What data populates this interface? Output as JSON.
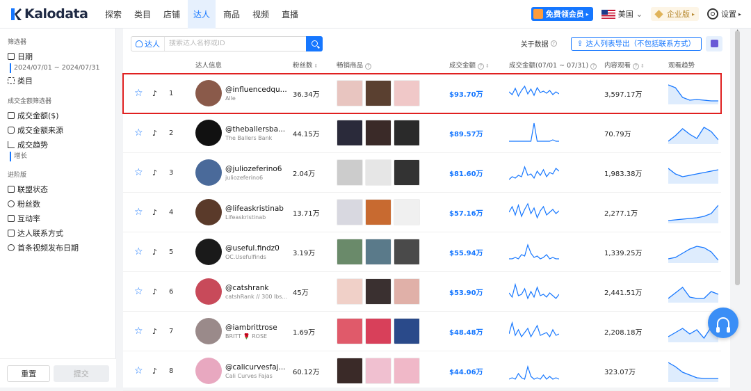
{
  "app": {
    "name": "Kalodata"
  },
  "nav": {
    "items": [
      "探索",
      "类目",
      "店铺",
      "达人",
      "商品",
      "视频",
      "直播"
    ],
    "active_index": 3,
    "promo_label": "免费领会员",
    "country": "美国",
    "enterprise_label": "企业版",
    "settings_label": "设置"
  },
  "sidebar": {
    "filter_title": "筛选器",
    "date_label": "日期",
    "date_range": "2024/07/01 ~ 2024/07/31",
    "category_label": "类目",
    "gmv_filter_title": "成交金额筛选器",
    "gmv_items": [
      "成交金额($)",
      "成交金额来源",
      "成交趋势"
    ],
    "trend_sub": "增长",
    "advanced_title": "进阶版",
    "advanced_items": [
      "联盟状态",
      "粉丝数",
      "互动率",
      "达人联系方式",
      "首条视频发布日期"
    ],
    "reset_label": "重置",
    "submit_label": "提交"
  },
  "toolbar": {
    "search_type": "达人",
    "search_placeholder": "搜索达人名称或ID",
    "about_label": "关于数据",
    "export_label": "达人列表导出（不包括联系方式）"
  },
  "table": {
    "headers": {
      "info": "达人信息",
      "followers": "粉丝数",
      "products": "畅销商品",
      "gmv": "成交金额",
      "gmv_range": "成交金额(07/01 ~ 07/31)",
      "views": "内容观看",
      "trend": "观看趋势"
    },
    "rows": [
      {
        "rank": "1",
        "handle": "@influencedqu...",
        "sub": "Alle",
        "followers": "36.34万",
        "gmv": "$93.70万",
        "views": "3,597.17万",
        "avatar_color": "#8a5a4a",
        "products": [
          "#e8c5c0",
          "#5a4030",
          "#f0c8c8"
        ],
        "spark": [
          14,
          18,
          9,
          20,
          12,
          6,
          17,
          10,
          19,
          8,
          15,
          13,
          16,
          12,
          18,
          14,
          17
        ],
        "trend": [
          4,
          8,
          22,
          26,
          25,
          26,
          27,
          27
        ]
      },
      {
        "rank": "2",
        "handle": "@theballersba...",
        "sub": "The Ballers Bank",
        "followers": "44.15万",
        "gmv": "$89.57万",
        "views": "70.79万",
        "avatar_color": "#111111",
        "products": [
          "#2a2a3a",
          "#3a2a28",
          "#2a2a2a"
        ],
        "spark": [
          28,
          28,
          28,
          28,
          28,
          28,
          28,
          28,
          2,
          28,
          28,
          28,
          28,
          28,
          26,
          28,
          28
        ],
        "trend": [
          28,
          20,
          10,
          18,
          24,
          8,
          14,
          26
        ]
      },
      {
        "rank": "3",
        "handle": "@juliozeferino6",
        "sub": "juliozeferino6",
        "followers": "2.04万",
        "gmv": "$81.60万",
        "views": "1,983.38万",
        "avatar_color": "#4a6a9a",
        "products": [
          "#cccccc",
          "#e6e6e6",
          "#333333"
        ],
        "spark": [
          26,
          22,
          24,
          20,
          22,
          8,
          20,
          18,
          24,
          14,
          20,
          12,
          22,
          16,
          18,
          10,
          14
        ],
        "trend": [
          10,
          18,
          22,
          20,
          18,
          16,
          14,
          12
        ]
      },
      {
        "rank": "4",
        "handle": "@lifeaskristinab",
        "sub": "Lifeaskristinab",
        "followers": "13.71万",
        "gmv": "$57.16万",
        "views": "2,277.1万",
        "avatar_color": "#5a3a2a",
        "products": [
          "#d8d8e0",
          "#c86a30",
          "#f0f0f0"
        ],
        "spark": [
          16,
          8,
          20,
          6,
          22,
          12,
          4,
          18,
          10,
          24,
          14,
          8,
          20,
          16,
          12,
          18,
          14
        ],
        "trend": [
          28,
          27,
          26,
          25,
          24,
          22,
          18,
          6
        ]
      },
      {
        "rank": "5",
        "handle": "@useful.findz0",
        "sub": "OC.Usefulfinds",
        "followers": "3.19万",
        "gmv": "$55.94万",
        "views": "1,339.25万",
        "avatar_color": "#1a1a1a",
        "products": [
          "#6a8a6a",
          "#5a7a8a",
          "#4a4a4a"
        ],
        "spark": [
          26,
          26,
          24,
          26,
          20,
          22,
          6,
          18,
          24,
          22,
          26,
          24,
          20,
          26,
          24,
          26,
          26
        ],
        "trend": [
          26,
          24,
          18,
          12,
          8,
          10,
          16,
          28
        ]
      },
      {
        "rank": "6",
        "handle": "@catshrank",
        "sub": "catshRank // 300 lbs...",
        "followers": "45万",
        "gmv": "$53.90万",
        "views": "2,441.51万",
        "avatar_color": "#c84a5a",
        "products": [
          "#f0d0c8",
          "#3a3030",
          "#e0b0a8"
        ],
        "spark": [
          18,
          24,
          6,
          22,
          20,
          12,
          26,
          16,
          24,
          10,
          22,
          20,
          24,
          18,
          22,
          26,
          20
        ],
        "trend": [
          26,
          18,
          10,
          24,
          26,
          26,
          16,
          20
        ]
      },
      {
        "rank": "7",
        "handle": "@iambrittrose",
        "sub": "BRITT 🌹 ROSE",
        "followers": "1.69万",
        "gmv": "$48.48万",
        "views": "2,208.18万",
        "avatar_color": "#9a8a8a",
        "products": [
          "#e05a6a",
          "#d8405a",
          "#2a4a8a"
        ],
        "spark": [
          20,
          4,
          22,
          14,
          24,
          18,
          12,
          24,
          16,
          8,
          22,
          20,
          18,
          24,
          14,
          22,
          20
        ],
        "trend": [
          24,
          18,
          12,
          20,
          14,
          26,
          10,
          22
        ]
      },
      {
        "rank": "8",
        "handle": "@calicurvesfaj...",
        "sub": "Cali Curves Fajas",
        "followers": "60.12万",
        "gmv": "$44.06万",
        "views": "323.07万",
        "avatar_color": "#e8a8c0",
        "products": [
          "#3a2a28",
          "#f0c0d0",
          "#f0b8c8"
        ],
        "spark": [
          28,
          26,
          28,
          20,
          26,
          28,
          10,
          24,
          28,
          26,
          28,
          22,
          28,
          24,
          28,
          26,
          28
        ],
        "trend": [
          4,
          10,
          18,
          22,
          26,
          27,
          27,
          27
        ]
      }
    ]
  },
  "colors": {
    "accent": "#1677ff",
    "highlight": "#e02020"
  },
  "icons": [
    "logo-icon",
    "gift-icon",
    "us-flag-icon",
    "diamond-icon",
    "gear-icon",
    "calendar-icon",
    "grid-icon",
    "search-icon",
    "star-icon",
    "tiktok-icon",
    "headset-icon"
  ]
}
